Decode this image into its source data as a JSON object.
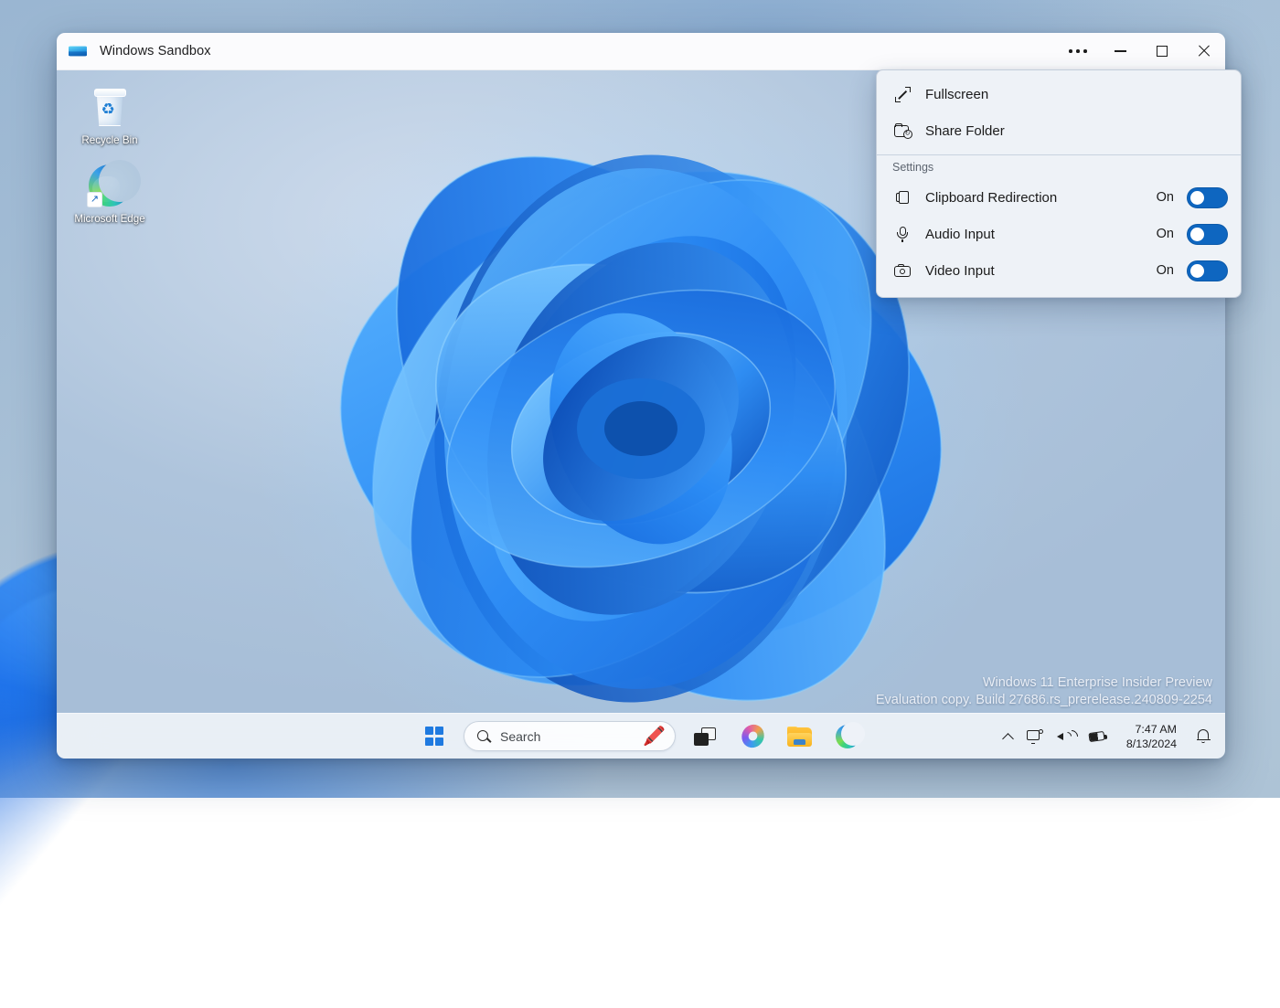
{
  "host": {
    "name": "host-desktop"
  },
  "window": {
    "app_icon": "windows-sandbox-icon",
    "title": "Windows Sandbox",
    "controls": {
      "more_label": "•••",
      "minimize_label": "Minimize",
      "maximize_label": "Maximize",
      "close_label": "Close"
    }
  },
  "menu": {
    "items": [
      {
        "icon": "fullscreen-icon",
        "label": "Fullscreen"
      },
      {
        "icon": "share-folder-icon",
        "label": "Share Folder"
      }
    ],
    "section_label": "Settings",
    "settings": [
      {
        "icon": "clipboard-icon",
        "label": "Clipboard Redirection",
        "state": "On",
        "enabled": true
      },
      {
        "icon": "microphone-icon",
        "label": "Audio Input",
        "state": "On",
        "enabled": true
      },
      {
        "icon": "camera-icon",
        "label": "Video Input",
        "state": "On",
        "enabled": true
      }
    ]
  },
  "desktop": {
    "icons": [
      {
        "name": "recycle-bin",
        "label": "Recycle Bin"
      },
      {
        "name": "microsoft-edge",
        "label": "Microsoft Edge"
      }
    ],
    "watermark": {
      "line1": "Windows 11 Enterprise Insider Preview",
      "line2": "Evaluation copy. Build 27686.rs_prerelease.240809-2254"
    }
  },
  "taskbar": {
    "start_label": "Start",
    "search": {
      "placeholder": "Search",
      "value": "",
      "emoji": "🖍️"
    },
    "apps": [
      {
        "name": "task-view",
        "label": "Task View"
      },
      {
        "name": "copilot",
        "label": "Copilot"
      },
      {
        "name": "file-explorer",
        "label": "File Explorer"
      },
      {
        "name": "microsoft-edge",
        "label": "Microsoft Edge"
      }
    ],
    "tray": {
      "show_hidden_label": "Show hidden icons",
      "network_label": "Network",
      "volume_label": "Volume",
      "battery_label": "Battery",
      "time": "7:47 AM",
      "date": "8/13/2024",
      "notifications_label": "Notifications"
    }
  },
  "colors": {
    "accent": "#0e66c0",
    "menu_bg": "#eef2f7",
    "titlebar_bg": "#fbfbfd",
    "taskbar_bg": "#eef2f8"
  }
}
